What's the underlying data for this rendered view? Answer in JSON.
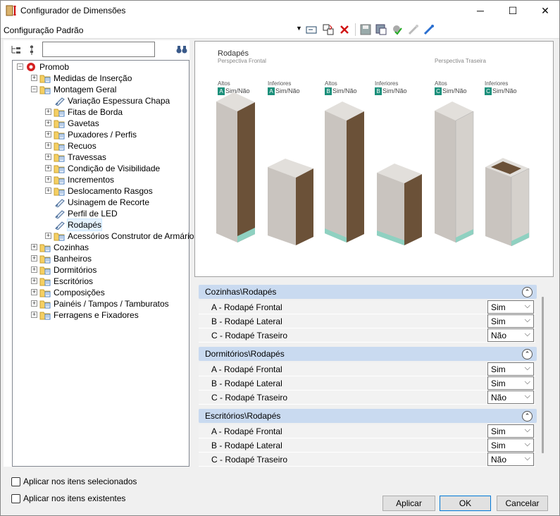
{
  "window": {
    "title": "Configurador de Dimensões",
    "minimize": "─",
    "maximize": "☐",
    "close": "✕"
  },
  "toolbar": {
    "config_name": "Configuração Padrão"
  },
  "tree": {
    "search_value": "",
    "nodes": [
      {
        "label": "Promob",
        "level": 0,
        "expanded": true
      },
      {
        "label": "Medidas de Inserção",
        "level": 1,
        "expanded": false
      },
      {
        "label": "Montagem Geral",
        "level": 1,
        "expanded": true
      },
      {
        "label": "Variação Espessura Chapa",
        "level": 2,
        "leaf": true
      },
      {
        "label": "Fitas de Borda",
        "level": 2,
        "expanded": false
      },
      {
        "label": "Gavetas",
        "level": 2,
        "expanded": false
      },
      {
        "label": "Puxadores / Perfis",
        "level": 2,
        "expanded": false
      },
      {
        "label": "Recuos",
        "level": 2,
        "expanded": false
      },
      {
        "label": "Travessas",
        "level": 2,
        "expanded": false
      },
      {
        "label": "Condição de Visibilidade",
        "level": 2,
        "expanded": false
      },
      {
        "label": "Incrementos",
        "level": 2,
        "expanded": false
      },
      {
        "label": "Deslocamento Rasgos",
        "level": 2,
        "expanded": false
      },
      {
        "label": "Usinagem de Recorte",
        "level": 2,
        "leaf": true
      },
      {
        "label": "Perfil de LED",
        "level": 2,
        "leaf": true
      },
      {
        "label": "Rodapés",
        "level": 2,
        "leaf": true,
        "selected": true
      },
      {
        "label": "Acessórios Construtor de Armários",
        "level": 2,
        "expanded": false
      },
      {
        "label": "Cozinhas",
        "level": 1,
        "expanded": false
      },
      {
        "label": "Banheiros",
        "level": 1,
        "expanded": false
      },
      {
        "label": "Dormitórios",
        "level": 1,
        "expanded": false
      },
      {
        "label": "Escritórios",
        "level": 1,
        "expanded": false
      },
      {
        "label": "Composições",
        "level": 1,
        "expanded": false
      },
      {
        "label": "Painéis / Tampos / Tamburatos",
        "level": 1,
        "expanded": false
      },
      {
        "label": "Ferragens e Fixadores",
        "level": 1,
        "expanded": false
      }
    ]
  },
  "preview": {
    "title": "Rodapés",
    "front_label": "Perspectiva Frontal",
    "back_label": "Perspectiva Traseira",
    "groups": [
      {
        "altos": "Altos",
        "altos_letter": "A",
        "altos_opt": "Sim/Não",
        "inf": "Inferiores",
        "inf_letter": "A",
        "inf_opt": "Sim/Não"
      },
      {
        "altos": "Altos",
        "altos_letter": "B",
        "altos_opt": "Sim/Não",
        "inf": "Inferiores",
        "inf_letter": "B",
        "inf_opt": "Sim/Não"
      },
      {
        "altos": "Altos",
        "altos_letter": "C",
        "altos_opt": "Sim/Não",
        "inf": "Inferiores",
        "inf_letter": "C",
        "inf_opt": "Sim/Não"
      }
    ]
  },
  "props": [
    {
      "group": "Cozinhas\\Rodapés",
      "rows": [
        {
          "label": "A - Rodapé Frontal",
          "value": "Sim"
        },
        {
          "label": "B - Rodapé Lateral",
          "value": "Sim"
        },
        {
          "label": "C -  Rodapé Traseiro",
          "value": "Não"
        }
      ]
    },
    {
      "group": "Dormitórios\\Rodapés",
      "rows": [
        {
          "label": "A - Rodapé Frontal",
          "value": "Sim"
        },
        {
          "label": "B - Rodapé Lateral",
          "value": "Sim"
        },
        {
          "label": "C -  Rodapé Traseiro",
          "value": "Não"
        }
      ]
    },
    {
      "group": "Escritórios\\Rodapés",
      "rows": [
        {
          "label": "A - Rodapé Frontal",
          "value": "Sim"
        },
        {
          "label": "B - Rodapé Lateral",
          "value": "Sim"
        },
        {
          "label": "C -  Rodapé Traseiro",
          "value": "Não"
        }
      ]
    }
  ],
  "options": {
    "apply_selected": "Aplicar nos itens selecionados",
    "apply_existing": "Aplicar nos itens existentes"
  },
  "buttons": {
    "apply": "Aplicar",
    "ok": "OK",
    "cancel": "Cancelar"
  },
  "colors": {
    "accent": "#1a8f7a",
    "toe_kick": "#8fd1c1",
    "wood": "#6b5138",
    "panel": "#c9c4bf",
    "group_bg": "#c9daf0"
  }
}
